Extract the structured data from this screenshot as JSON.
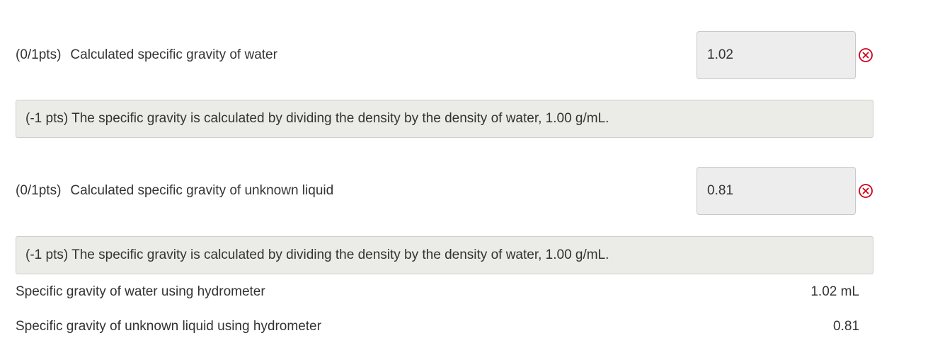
{
  "questions": [
    {
      "points": "(0/1pts)",
      "label": "Calculated specific gravity of water",
      "answer": "1.02",
      "status": "incorrect",
      "status_icon": "x-circle-icon",
      "feedback": "(-1 pts) The specific gravity is calculated by dividing the density by the density of water, 1.00 g/mL."
    },
    {
      "points": "(0/1pts)",
      "label": "Calculated specific gravity of unknown liquid",
      "answer": "0.81",
      "status": "incorrect",
      "status_icon": "x-circle-icon",
      "feedback": "(-1 pts) The specific gravity is calculated by dividing the density by the density of water, 1.00 g/mL."
    }
  ],
  "measurements": [
    {
      "label": "Specific gravity of water using hydrometer",
      "value": "1.02 mL"
    },
    {
      "label": "Specific gravity of unknown liquid using hydrometer",
      "value": "0.81"
    }
  ],
  "colors": {
    "incorrect": "#d0021b",
    "feedback_bg": "#ebebe7",
    "input_bg": "#ededed",
    "text": "#333333"
  }
}
